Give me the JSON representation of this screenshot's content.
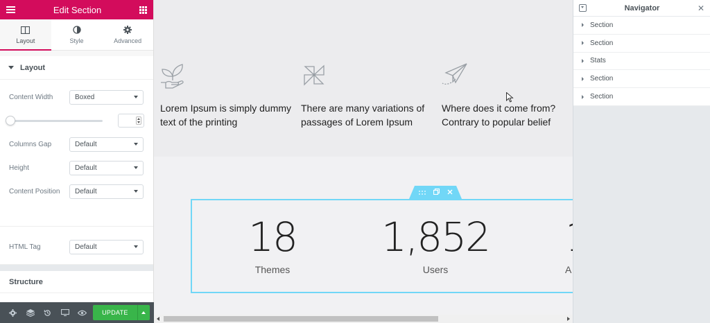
{
  "panel": {
    "title": "Edit Section",
    "tabs": [
      {
        "label": "Layout",
        "icon": "columns-icon"
      },
      {
        "label": "Style",
        "icon": "contrast-icon"
      },
      {
        "label": "Advanced",
        "icon": "gear-icon"
      }
    ],
    "layout_section": "Layout",
    "controls": {
      "content_width": {
        "label": "Content Width",
        "value": "Boxed"
      },
      "columns_gap": {
        "label": "Columns Gap",
        "value": "Default"
      },
      "height": {
        "label": "Height",
        "value": "Default"
      },
      "content_position": {
        "label": "Content Position",
        "value": "Default"
      },
      "html_tag": {
        "label": "HTML Tag",
        "value": "Default"
      }
    },
    "structure_section": "Structure",
    "footer": {
      "update_label": "UPDATE"
    }
  },
  "canvas": {
    "features": [
      {
        "text": "Lorem Ipsum is simply dummy text of the printing",
        "icon": "plant-hand-icon"
      },
      {
        "text": "There are many variations of passages of Lorem Ipsum",
        "icon": "pinwheel-icon"
      },
      {
        "text": "Where does it come from? Contrary to popular belief",
        "icon": "paper-plane-icon"
      }
    ],
    "stats": [
      {
        "number": "18",
        "label": "Themes"
      },
      {
        "number": "1,852",
        "label": "Users"
      },
      {
        "number": "1",
        "label": "A"
      }
    ]
  },
  "navigator": {
    "title": "Navigator",
    "items": [
      "Section",
      "Section",
      "Stats",
      "Section",
      "Section"
    ]
  },
  "colors": {
    "brand": "#d30c5c",
    "selection": "#71d7f7",
    "update": "#39b54a"
  }
}
